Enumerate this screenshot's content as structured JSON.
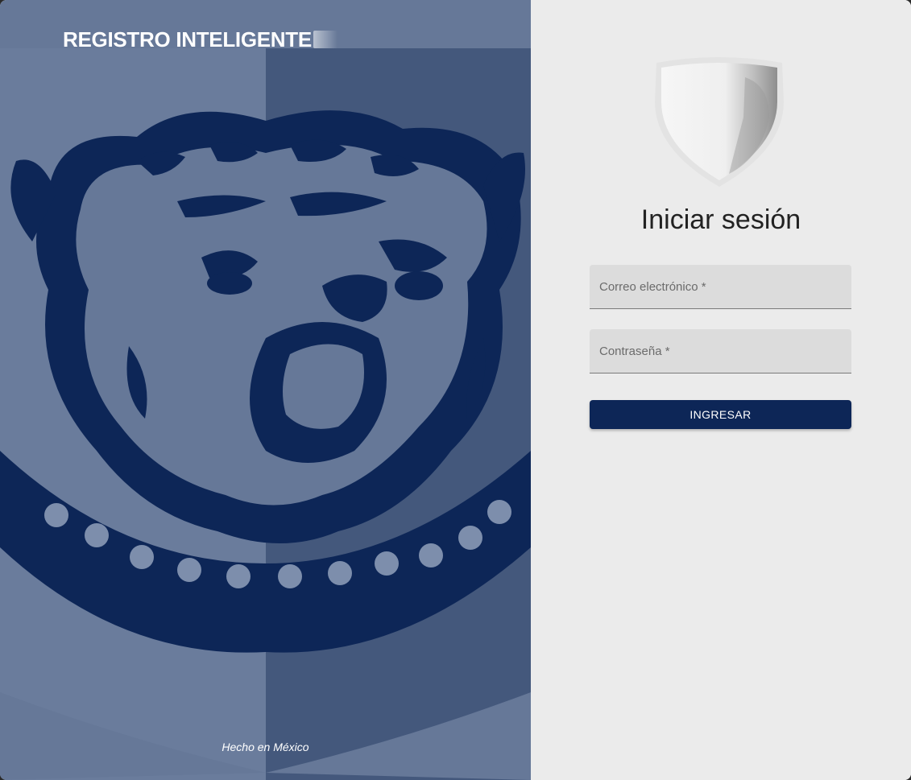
{
  "hero": {
    "title": "REGISTRO INTELIGENTE",
    "footer": "Hecho en México",
    "background_color": "#667898",
    "artwork_color": "#0d2657",
    "artwork_icon": "bulldog-shield-icon"
  },
  "login": {
    "title": "Iniciar sesión",
    "logo_icon": "shield-logo-icon",
    "email": {
      "placeholder": "Correo electrónico *",
      "value": ""
    },
    "password": {
      "placeholder": "Contraseña *",
      "value": ""
    },
    "submit_label": "INGRESAR",
    "button_color": "#0d2657"
  }
}
